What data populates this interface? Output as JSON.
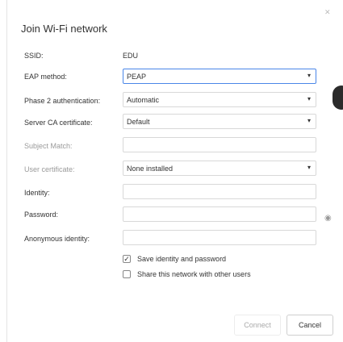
{
  "dialog": {
    "title": "Join Wi-Fi network"
  },
  "form": {
    "ssid": {
      "label": "SSID:",
      "value": "EDU"
    },
    "eap_method": {
      "label": "EAP method:",
      "value": "PEAP"
    },
    "phase2": {
      "label": "Phase 2 authentication:",
      "value": "Automatic"
    },
    "server_ca": {
      "label": "Server CA certificate:",
      "value": "Default"
    },
    "subject_match": {
      "label": "Subject Match:",
      "value": ""
    },
    "user_cert": {
      "label": "User certificate:",
      "value": "None installed"
    },
    "identity": {
      "label": "Identity:",
      "value": ""
    },
    "password": {
      "label": "Password:",
      "value": ""
    },
    "anonymous_identity": {
      "label": "Anonymous identity:",
      "value": ""
    }
  },
  "options": {
    "save_identity": {
      "label": "Save identity and password",
      "checked": true
    },
    "share_network": {
      "label": "Share this network with other users",
      "checked": false
    }
  },
  "buttons": {
    "connect": "Connect",
    "cancel": "Cancel"
  },
  "icons": {
    "close": "close-icon",
    "eye": "eye-icon",
    "dropdown": "chevron-down-icon",
    "check": "check-icon"
  },
  "colors": {
    "focus_border": "#4a86e8",
    "disabled_text": "#9a9a9a"
  }
}
